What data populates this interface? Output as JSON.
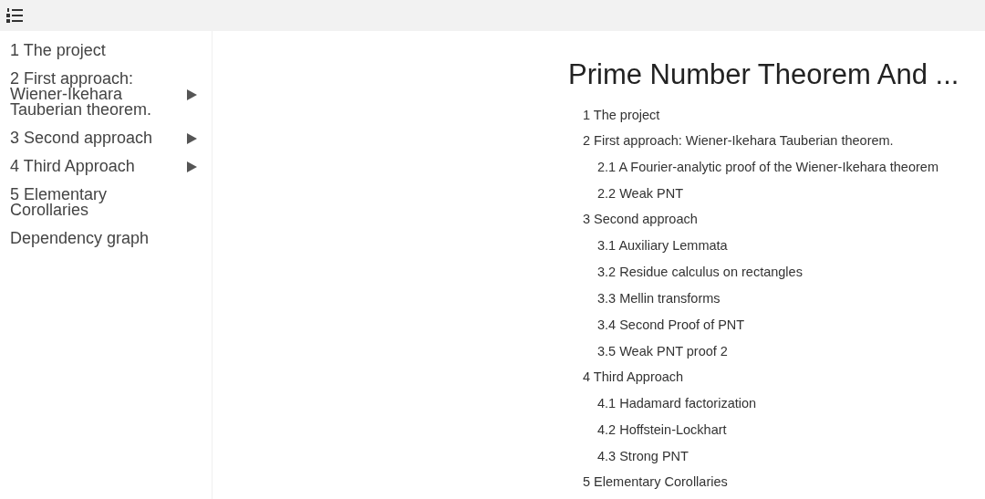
{
  "sidebar": {
    "items": [
      {
        "label": "1 The project",
        "collapsible": false
      },
      {
        "label": "2 First approach: Wiener-Ikehara Tauberian theorem.",
        "collapsible": true
      },
      {
        "label": "3 Second approach",
        "collapsible": true
      },
      {
        "label": "4 Third Approach",
        "collapsible": true
      },
      {
        "label": "5 Elementary Corollaries",
        "collapsible": false
      },
      {
        "label": "Dependency graph",
        "collapsible": false
      }
    ]
  },
  "title": "Prime Number Theorem And ...",
  "toc": [
    {
      "label": "1 The project"
    },
    {
      "label": "2 First approach: Wiener-Ikehara Tauberian theorem.",
      "children": [
        {
          "label": "2.1 A Fourier-analytic proof of the Wiener-Ikehara theorem"
        },
        {
          "label": "2.2 Weak PNT"
        }
      ]
    },
    {
      "label": "3 Second approach",
      "children": [
        {
          "label": "3.1 Auxiliary Lemmata"
        },
        {
          "label": "3.2 Residue calculus on rectangles"
        },
        {
          "label": "3.3 Mellin transforms"
        },
        {
          "label": "3.4 Second Proof of PNT"
        },
        {
          "label": "3.5 Weak PNT proof 2"
        }
      ]
    },
    {
      "label": "4 Third Approach",
      "children": [
        {
          "label": "4.1 Hadamard factorization"
        },
        {
          "label": "4.2 Hoffstein-Lockhart"
        },
        {
          "label": "4.3 Strong PNT"
        }
      ]
    },
    {
      "label": "5 Elementary Corollaries"
    }
  ]
}
